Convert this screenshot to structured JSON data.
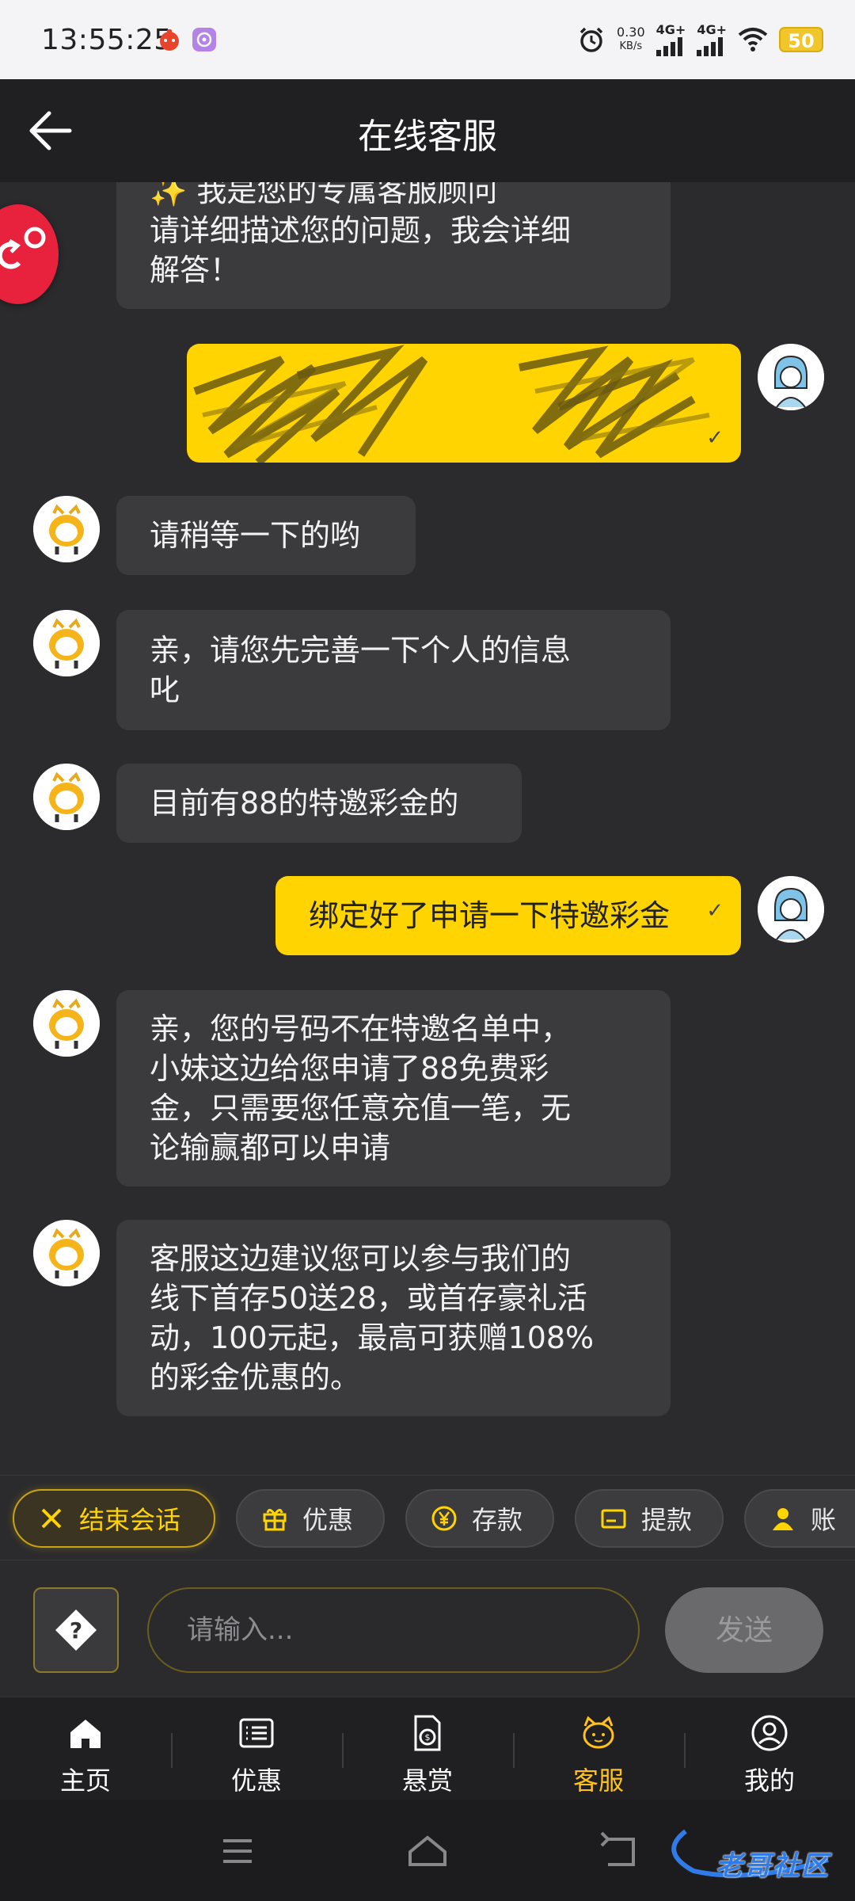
{
  "status_bar": {
    "time": "13:55:25",
    "net_speed": "0.30",
    "net_unit": "KB/s",
    "signal1": "4G+",
    "signal2": "4G+",
    "battery": "50"
  },
  "header": {
    "title": "在线客服"
  },
  "messages": [
    {
      "side": "agent",
      "lines": [
        "✨ 我是您的专属客服顾问",
        "请详细描述您的问题，我会详细",
        "解答！"
      ]
    },
    {
      "side": "user",
      "redacted": true,
      "read": true
    },
    {
      "side": "agent",
      "lines": [
        "请稍等一下的哟"
      ]
    },
    {
      "side": "agent",
      "lines": [
        "亲，请您先完善一下个人的信息",
        "叱"
      ]
    },
    {
      "side": "agent",
      "lines": [
        "目前有88的特邀彩金的"
      ]
    },
    {
      "side": "user",
      "lines": [
        "绑定好了申请一下特邀彩金"
      ],
      "read": true
    },
    {
      "side": "agent",
      "lines": [
        "亲，您的号码不在特邀名单中，",
        "小妹这边给您申请了88免费彩",
        "金，只需要您任意充值一笔，无",
        "论输赢都可以申请"
      ]
    },
    {
      "side": "agent",
      "lines": [
        "客服这边建议您可以参与我们的",
        "线下首存50送28，或首存豪礼活",
        "动，100元起，最高可获赠108%",
        "的彩金优惠的。"
      ]
    }
  ],
  "quick_actions": [
    {
      "label": "结束会话",
      "icon": "close-icon"
    },
    {
      "label": "优惠",
      "icon": "gift-icon"
    },
    {
      "label": "存款",
      "icon": "yen-coin-icon"
    },
    {
      "label": "提款",
      "icon": "card-icon"
    },
    {
      "label": "账",
      "icon": "user-icon"
    }
  ],
  "input": {
    "placeholder": "请输入...",
    "send_label": "发送"
  },
  "bottom_nav": [
    {
      "label": "主页",
      "icon": "home-icon"
    },
    {
      "label": "优惠",
      "icon": "list-icon"
    },
    {
      "label": "悬赏",
      "icon": "document-coin-icon"
    },
    {
      "label": "客服",
      "icon": "customer-service-icon",
      "active": true
    },
    {
      "label": "我的",
      "icon": "profile-icon"
    }
  ],
  "watermark": {
    "text": "老哥社区"
  },
  "colors": {
    "accent": "#ffd400",
    "background": "#2b2b2d",
    "agent_bubble": "#3b3b3e",
    "header": "#202022",
    "active_nav": "#ffc21a"
  }
}
